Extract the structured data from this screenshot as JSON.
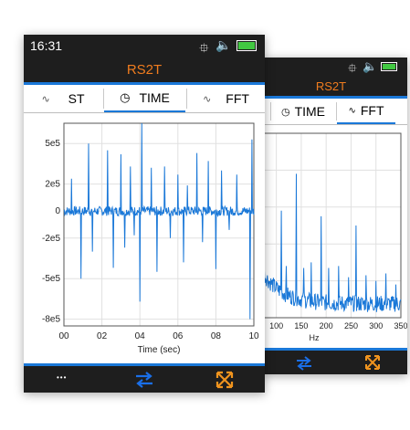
{
  "front": {
    "status": {
      "time": "16:31"
    },
    "title": "RS2T",
    "tabs": [
      {
        "label": "ST",
        "icon": "waveform-icon"
      },
      {
        "label": "TIME",
        "icon": "clock-icon",
        "active": true
      },
      {
        "label": "FFT",
        "icon": "waveform-icon"
      }
    ],
    "bottom": {
      "more": "•••"
    }
  },
  "back": {
    "title": "RS2T",
    "tabs": [
      {
        "label": "TIME",
        "icon": "clock-icon"
      },
      {
        "label": "FFT",
        "icon": "waveform-icon",
        "active": true
      }
    ]
  },
  "colors": {
    "accent": "#f07c1e",
    "line": "#1a78d8",
    "bar": "#1e1e1e",
    "swap": "#1a6fe8",
    "expand": "#f0941e"
  },
  "chart_data": [
    {
      "type": "line",
      "xlabel": "Time (sec)",
      "ylabel": "",
      "xticks": [
        "00",
        "02",
        "04",
        "06",
        "08",
        "10"
      ],
      "yticks": [
        "5e5",
        "2e5",
        "0",
        "-2e5",
        "-5e5",
        "-8e5"
      ],
      "xlim": [
        0,
        10
      ],
      "ylim": [
        -850000,
        650000
      ],
      "grid": true,
      "spikes": [
        {
          "x": 0.4,
          "y": 240000
        },
        {
          "x": 0.9,
          "y": -500000
        },
        {
          "x": 1.3,
          "y": 500000
        },
        {
          "x": 1.5,
          "y": -300000
        },
        {
          "x": 2.3,
          "y": 450000
        },
        {
          "x": 2.6,
          "y": -420000
        },
        {
          "x": 3.0,
          "y": 420000
        },
        {
          "x": 3.2,
          "y": -270000
        },
        {
          "x": 3.5,
          "y": 330000
        },
        {
          "x": 3.7,
          "y": -180000
        },
        {
          "x": 4.0,
          "y": -670000
        },
        {
          "x": 4.1,
          "y": 650000
        },
        {
          "x": 4.6,
          "y": 320000
        },
        {
          "x": 4.9,
          "y": -450000
        },
        {
          "x": 5.3,
          "y": 330000
        },
        {
          "x": 5.6,
          "y": -200000
        },
        {
          "x": 6.0,
          "y": 270000
        },
        {
          "x": 6.3,
          "y": -380000
        },
        {
          "x": 6.5,
          "y": 190000
        },
        {
          "x": 7.0,
          "y": 430000
        },
        {
          "x": 7.3,
          "y": -230000
        },
        {
          "x": 7.6,
          "y": 370000
        },
        {
          "x": 8.0,
          "y": -430000
        },
        {
          "x": 8.3,
          "y": 300000
        },
        {
          "x": 8.7,
          "y": -140000
        },
        {
          "x": 9.1,
          "y": 270000
        },
        {
          "x": 9.8,
          "y": -800000
        },
        {
          "x": 9.9,
          "y": 530000
        }
      ]
    },
    {
      "type": "line",
      "xlabel": "Hz",
      "ylabel": "",
      "xticks": [
        "100",
        "150",
        "200",
        "250",
        "300",
        "350"
      ],
      "xlim": [
        75,
        350
      ],
      "grid": true,
      "peaks": [
        {
          "x": 110,
          "y": 0.58
        },
        {
          "x": 120,
          "y": 0.28
        },
        {
          "x": 140,
          "y": 0.78
        },
        {
          "x": 155,
          "y": 0.27
        },
        {
          "x": 170,
          "y": 0.3
        },
        {
          "x": 190,
          "y": 0.55
        },
        {
          "x": 205,
          "y": 0.27
        },
        {
          "x": 225,
          "y": 0.28
        },
        {
          "x": 245,
          "y": 0.22
        },
        {
          "x": 260,
          "y": 0.5
        },
        {
          "x": 280,
          "y": 0.23
        },
        {
          "x": 300,
          "y": 0.2
        },
        {
          "x": 320,
          "y": 0.24
        },
        {
          "x": 340,
          "y": 0.18
        }
      ]
    }
  ]
}
